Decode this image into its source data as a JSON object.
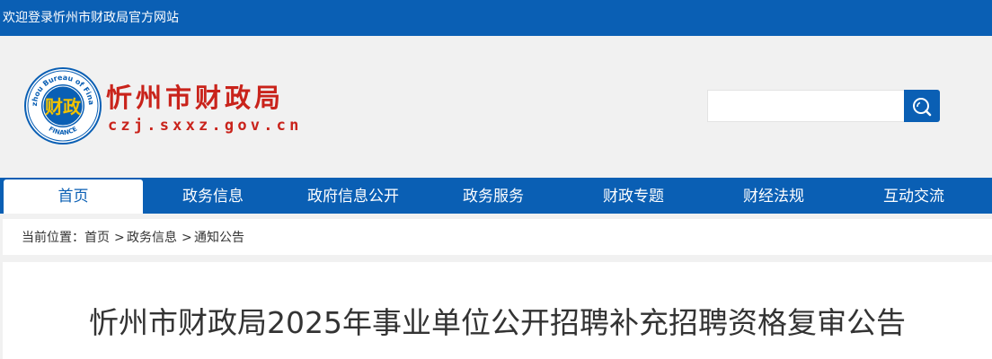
{
  "topbar": {
    "welcome": "欢迎登录忻州市财政局官方网站"
  },
  "header": {
    "site_name": "忻州市财政局",
    "domain": "czj.sxxz.gov.cn",
    "logo": {
      "ring_text": "Xinzhou Bureau of Finance",
      "bottom_text": "FINANCE",
      "seal_text": "财政"
    }
  },
  "search": {
    "placeholder": "",
    "value": "",
    "icon": "search-icon"
  },
  "nav": {
    "items": [
      {
        "label": "首页",
        "active": true
      },
      {
        "label": "政务信息",
        "active": false
      },
      {
        "label": "政府信息公开",
        "active": false
      },
      {
        "label": "政务服务",
        "active": false
      },
      {
        "label": "财政专题",
        "active": false
      },
      {
        "label": "财经法规",
        "active": false
      },
      {
        "label": "互动交流",
        "active": false
      }
    ]
  },
  "breadcrumb": {
    "prefix": "当前位置：",
    "items": [
      "首页",
      "政务信息",
      "通知公告"
    ],
    "separator": ">"
  },
  "article": {
    "title": "忻州市财政局2025年事业单位公开招聘补充招聘资格复审公告"
  },
  "colors": {
    "brand_blue": "#0a5fb4",
    "brand_red": "#c9231b",
    "page_bg": "#f1f1f1"
  }
}
